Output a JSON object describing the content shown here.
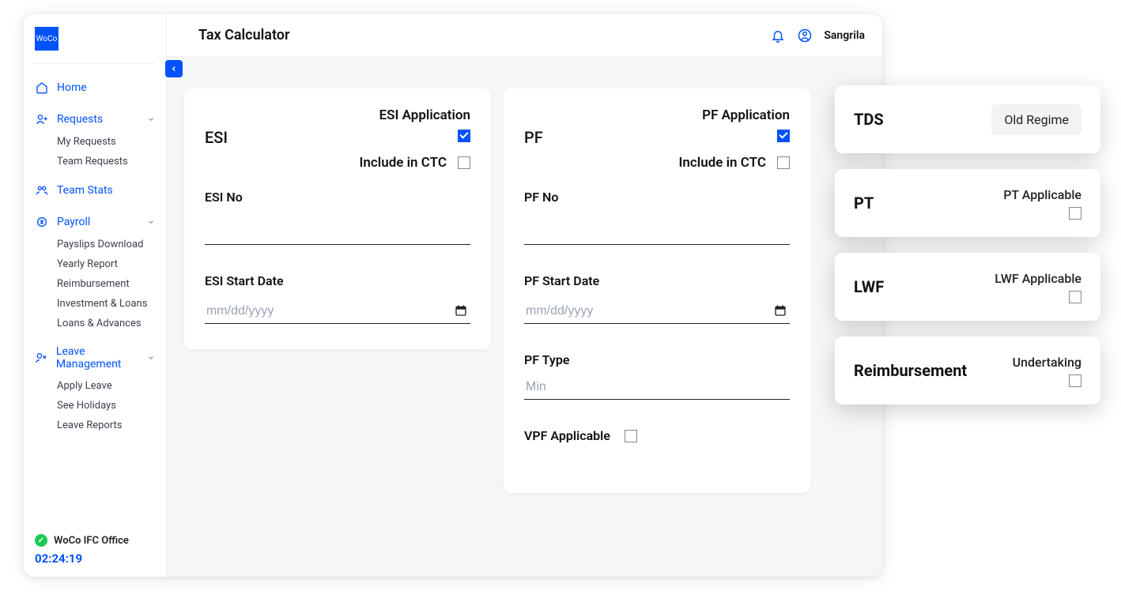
{
  "app": {
    "logo_text": "WoCo",
    "page_title": "Tax Calculator",
    "user_name": "Sangrila"
  },
  "sidebar": {
    "home": "Home",
    "requests": {
      "label": "Requests",
      "items": [
        "My Requests",
        "Team Requests"
      ]
    },
    "team_stats": "Team Stats",
    "payroll": {
      "label": "Payroll",
      "items": [
        "Payslips Download",
        "Yearly Report",
        "Reimbursement",
        "Investment & Loans",
        "Loans & Advances"
      ]
    },
    "leave": {
      "label": "Leave Management",
      "items": [
        "Apply Leave",
        "See Holidays",
        "Leave Reports"
      ]
    },
    "office": "WoCo IFC Office",
    "clock": "02:24:19"
  },
  "esi": {
    "title": "ESI",
    "app_label": "ESI Application",
    "app_checked": true,
    "include_label": "Include in CTC",
    "include_checked": false,
    "no_label": "ESI No",
    "no_value": "",
    "start_label": "ESI Start Date",
    "start_placeholder": "mm/dd/yyyy",
    "start_value": ""
  },
  "pf": {
    "title": "PF",
    "app_label": "PF Application",
    "app_checked": true,
    "include_label": "Include in CTC",
    "include_checked": false,
    "no_label": "PF No",
    "no_value": "",
    "start_label": "PF Start Date",
    "start_placeholder": "mm/dd/yyyy",
    "start_value": "",
    "type_label": "PF Type",
    "type_placeholder": "Min",
    "type_value": "",
    "vpf_label": "VPF Applicable",
    "vpf_checked": false
  },
  "float": {
    "tds": {
      "title": "TDS",
      "regime": "Old Regime"
    },
    "pt": {
      "title": "PT",
      "label": "PT Applicable",
      "checked": false
    },
    "lwf": {
      "title": "LWF",
      "label": "LWF Applicable",
      "checked": false
    },
    "reimb": {
      "title": "Reimbursement",
      "label": "Undertaking",
      "checked": false
    }
  }
}
